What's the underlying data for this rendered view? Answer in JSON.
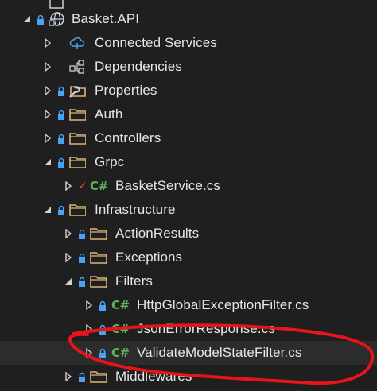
{
  "tree": {
    "project": "Basket.API",
    "connected_services": "Connected Services",
    "dependencies": "Dependencies",
    "properties": "Properties",
    "auth": "Auth",
    "controllers": "Controllers",
    "grpc": "Grpc",
    "basket_service": "BasketService.cs",
    "infrastructure": "Infrastructure",
    "action_results": "ActionResults",
    "exceptions": "Exceptions",
    "filters": "Filters",
    "http_filter": "HttpGlobalExceptionFilter.cs",
    "json_error": "JsonErrorResponse.cs",
    "validate_filter": "ValidateModelStateFilter.cs",
    "middlewares": "Middlewares"
  },
  "icons": {
    "cs_glyph": "C#",
    "check_glyph": "✓"
  },
  "colors": {
    "background": "#1f1f1f",
    "folder": "#dcb67a",
    "csharp": "#5db25d",
    "lock": "#4aa3f0",
    "annotation": "#e8141b"
  }
}
